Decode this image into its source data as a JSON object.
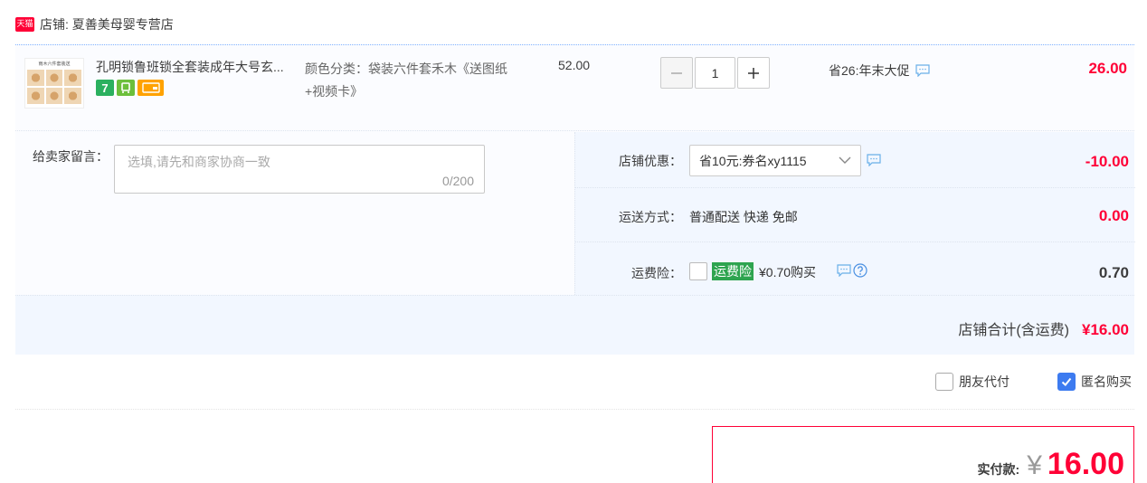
{
  "shop": {
    "logo_text": "天猫",
    "label": "店铺: 夏善美母婴专营店"
  },
  "item": {
    "thumb_title": "雨木六件套装送",
    "title": "孔明锁鲁班锁全套装成年大号玄...",
    "sku": "颜色分类：袋装六件套禾木《送图纸+视频卡》",
    "unit_price": "52.00",
    "quantity": "1",
    "promo": "省26:年末大促",
    "total": "26.00",
    "badges": [
      "7",
      "cert-icon",
      "card-icon"
    ]
  },
  "message": {
    "label": "给卖家留言：",
    "placeholder": "选填,请先和商家协商一致",
    "count": "0/200"
  },
  "coupon": {
    "label": "店铺优惠：",
    "selected": "省10元:券名xy1115",
    "value": "-10.00"
  },
  "shipping": {
    "label": "运送方式：",
    "text": "普通配送 快递 免邮",
    "value": "0.00"
  },
  "insurance": {
    "label": "运费险：",
    "tag": "运费险",
    "price": "¥0.70购买",
    "value": "0.70"
  },
  "subtotal": {
    "label": "店铺合计(含运费)",
    "value": "¥16.00"
  },
  "options": {
    "friend_pay": "朋友代付",
    "anonymous": "匿名购买"
  },
  "payment": {
    "label": "实付款:",
    "currency": "¥",
    "value": "16.00"
  },
  "colors": {
    "accent_red": "#ff0036",
    "blue_check": "#3d7bf0",
    "insurance_green": "#2ea44f"
  }
}
